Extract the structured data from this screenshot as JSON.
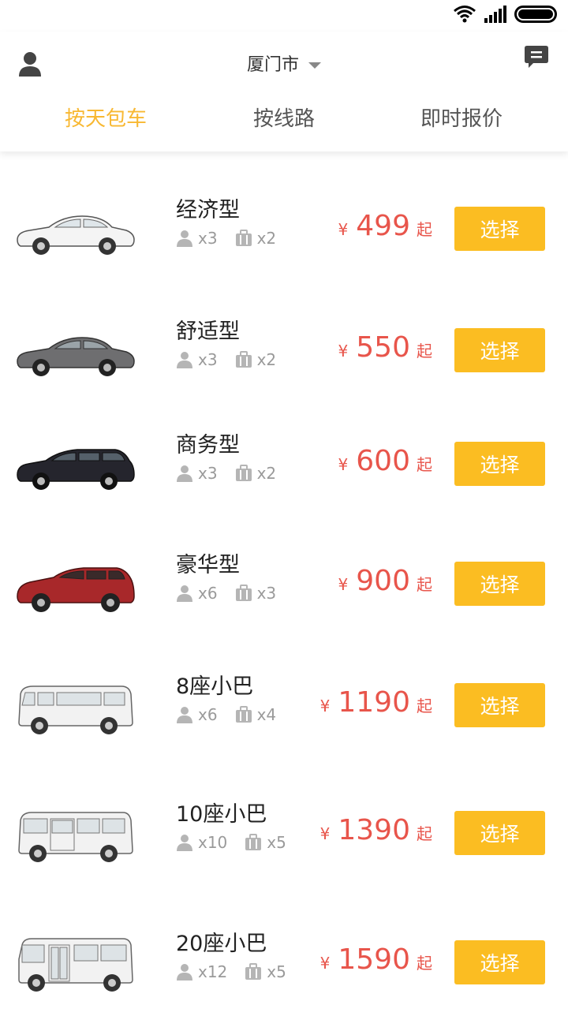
{
  "header": {
    "city": "厦门市",
    "tabs": [
      {
        "label": "按天包车",
        "active": true
      },
      {
        "label": "按线路",
        "active": false
      },
      {
        "label": "即时报价",
        "active": false
      }
    ]
  },
  "colors": {
    "accent": "#fbbd22",
    "price": "#e8554b",
    "active_tab": "#f8b832"
  },
  "vehicles": [
    {
      "name": "经济型",
      "passengers": "x3",
      "luggage": "x2",
      "currency": "¥",
      "price": "499",
      "suffix": "起",
      "button": "选择",
      "car_icon": "white-sedan"
    },
    {
      "name": "舒适型",
      "passengers": "x3",
      "luggage": "x2",
      "currency": "¥",
      "price": "550",
      "suffix": "起",
      "button": "选择",
      "car_icon": "gray-sedan"
    },
    {
      "name": "商务型",
      "passengers": "x3",
      "luggage": "x2",
      "currency": "¥",
      "price": "600",
      "suffix": "起",
      "button": "选择",
      "car_icon": "black-wagon"
    },
    {
      "name": "豪华型",
      "passengers": "x6",
      "luggage": "x3",
      "currency": "¥",
      "price": "900",
      "suffix": "起",
      "button": "选择",
      "car_icon": "red-suv"
    },
    {
      "name": "8座小巴",
      "passengers": "x6",
      "luggage": "x4",
      "currency": "¥",
      "price": "1190",
      "suffix": "起",
      "button": "选择",
      "car_icon": "white-van"
    },
    {
      "name": "10座小巴",
      "passengers": "x10",
      "luggage": "x5",
      "currency": "¥",
      "price": "1390",
      "suffix": "起",
      "button": "选择",
      "car_icon": "white-minibus"
    },
    {
      "name": "20座小巴",
      "passengers": "x12",
      "luggage": "x5",
      "currency": "¥",
      "price": "1590",
      "suffix": "起",
      "button": "选择",
      "car_icon": "white-bus"
    }
  ]
}
